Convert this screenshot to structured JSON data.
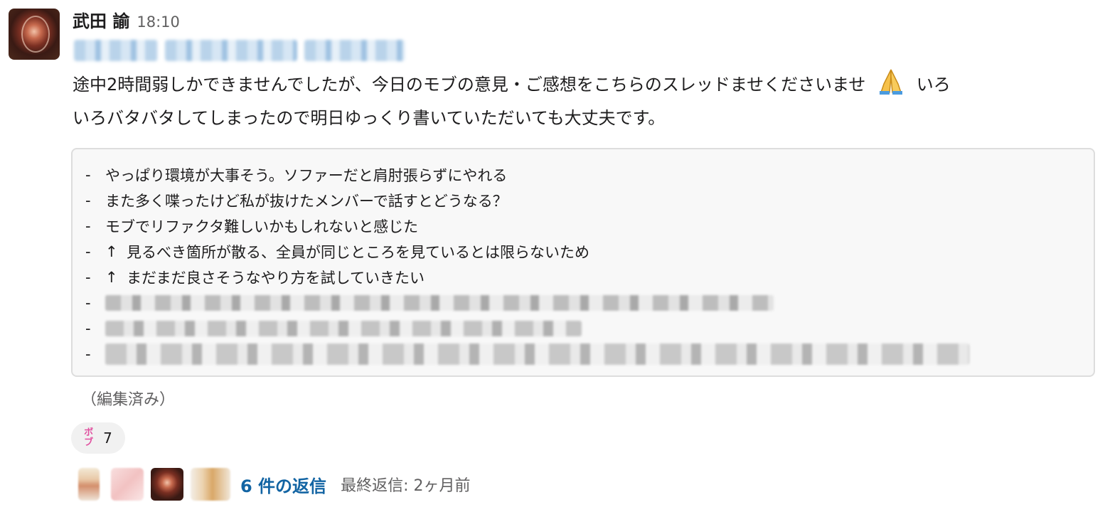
{
  "message": {
    "user": "武田 諭",
    "time": "18:10",
    "text_1": "途中2時間弱しかできませんでしたが、今日のモブの意見・ご感想をこちらのスレッドませくださいませ",
    "emoji": "folded-hands",
    "text_2": "いろいろバタバタしてしまったので明日ゆっくり書いていただいても大丈夫です。",
    "code_lines": [
      {
        "dash": "-",
        "arrow": "",
        "text": "やっぱり環境が大事そう。ソファーだと肩肘張らずにやれる"
      },
      {
        "dash": "-",
        "arrow": "",
        "text": "また多く喋ったけど私が抜けたメンバーで話すとどうなる？"
      },
      {
        "dash": "-",
        "arrow": "",
        "text": "モブでリファクタ難しいかもしれないと感じた"
      },
      {
        "dash": "-",
        "arrow": "↑",
        "text": "見るべき箇所が散る、全員が同じところを見ているとは限らないため"
      },
      {
        "dash": "-",
        "arrow": "↑",
        "text": "まだまだ良さそうなやり方を試していきたい"
      }
    ],
    "redacted_dashes": [
      "-",
      "-",
      "-"
    ],
    "edited": "（編集済み）"
  },
  "reaction": {
    "emoji_top": "ボ",
    "emoji_bottom": "ブ",
    "count": "7",
    "color": "#e04f9f"
  },
  "thread": {
    "reply_count": "6 件の返信",
    "last_reply": "最終返信: 2ヶ月前",
    "link_color": "#1264a3"
  }
}
